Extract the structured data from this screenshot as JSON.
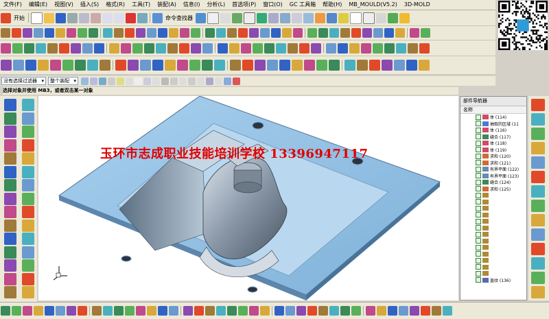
{
  "menubar": {
    "items": [
      "文件(F)",
      "编辑(E)",
      "视图(V)",
      "插入(S)",
      "格式(R)",
      "工具(T)",
      "装配(A)",
      "信息(I)",
      "分析(L)",
      "首选项(P)",
      "窗口(O)",
      "GC 工具箱",
      "帮助(H)",
      "MB_MOULD(V5.2)",
      "3D-MOLD"
    ]
  },
  "toolbar": {
    "start_label": "开始",
    "command_finder_label": "命令查找器"
  },
  "filter": {
    "type_filter": "没有选择过滤器",
    "scope": "整个装配"
  },
  "cue_line": "选择对象并使用 MB3，或者双击某一对象",
  "viewport": {
    "watermark": "玉环市志成职业技能培训学校 13396947117"
  },
  "navigator": {
    "title": "部件导航器",
    "column_name": "名称",
    "rows": [
      {
        "label": "体 (114)",
        "icon": "body-icon"
      },
      {
        "label": "抽取的区域 (11",
        "icon": "extract-icon"
      },
      {
        "label": "体 (116)",
        "icon": "body-icon"
      },
      {
        "label": "缝合 (117)",
        "icon": "sew-icon"
      },
      {
        "label": "体 (118)",
        "icon": "body-icon"
      },
      {
        "label": "体 (119)",
        "icon": "body-icon"
      },
      {
        "label": "求和 (120)",
        "icon": "unite-icon"
      },
      {
        "label": "求和 (121)",
        "icon": "unite-icon"
      },
      {
        "label": "有界平面 (122)",
        "icon": "plane-icon"
      },
      {
        "label": "有界平面 (123)",
        "icon": "plane-icon"
      },
      {
        "label": "缝合 (124)",
        "icon": "sew-icon"
      },
      {
        "label": "求和 (125)",
        "icon": "unite-icon"
      },
      {
        "label": "",
        "icon": "feature-icon"
      },
      {
        "label": "",
        "icon": "feature-icon"
      },
      {
        "label": "",
        "icon": "feature-icon"
      },
      {
        "label": "",
        "icon": "feature-icon"
      },
      {
        "label": "",
        "icon": "feature-icon"
      },
      {
        "label": "",
        "icon": "feature-icon"
      },
      {
        "label": "",
        "icon": "feature-icon"
      },
      {
        "label": "",
        "icon": "feature-icon"
      },
      {
        "label": "",
        "icon": "feature-icon"
      },
      {
        "label": "",
        "icon": "feature-icon"
      },
      {
        "label": "",
        "icon": "feature-icon"
      },
      {
        "label": "",
        "icon": "feature-icon"
      },
      {
        "label": "",
        "icon": "feature-icon"
      },
      {
        "label": "直纹 (136)",
        "icon": "ruled-icon"
      }
    ]
  },
  "colors": {
    "accent": "#3163c5",
    "mold_face": "#9fc8e6",
    "watermark": "#e00000"
  }
}
